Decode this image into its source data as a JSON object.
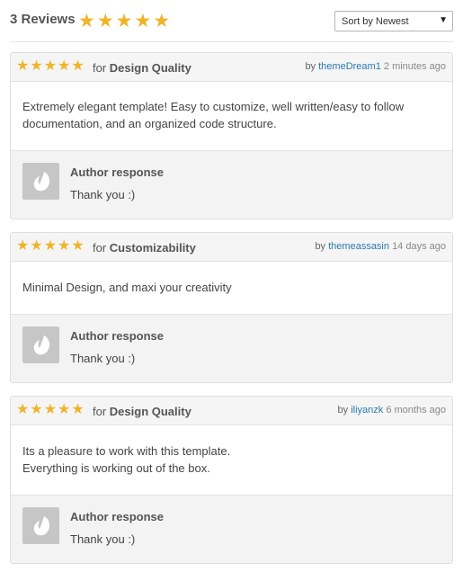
{
  "header": {
    "review_count": "3 Reviews",
    "rating_stars": 5,
    "sort": {
      "selected": "Sort by Newest"
    }
  },
  "colors": {
    "star": "#f0b42a",
    "link": "#2a7ab0"
  },
  "reviews": [
    {
      "stars": 5,
      "for_prefix": "for",
      "category": "Design Quality",
      "by_prefix": "by",
      "username": "themeDream1",
      "time": "2 minutes ago",
      "body": [
        "Extremely elegant template! Easy to customize, well written/easy to follow documentation, and an organized code structure."
      ],
      "response": {
        "title": "Author response",
        "text": "Thank you :)"
      }
    },
    {
      "stars": 5,
      "for_prefix": "for",
      "category": "Customizability",
      "by_prefix": "by",
      "username": "themeassasin",
      "time": "14 days ago",
      "body": [
        "Minimal Design, and maxi your creativity"
      ],
      "response": {
        "title": "Author response",
        "text": "Thank you :)"
      }
    },
    {
      "stars": 5,
      "for_prefix": "for",
      "category": "Design Quality",
      "by_prefix": "by",
      "username": "iliyanzk",
      "time": "6 months ago",
      "body": [
        "Its a pleasure to work with this template.",
        "Everything is working out of the box."
      ],
      "response": {
        "title": "Author response",
        "text": "Thank you :)"
      }
    }
  ]
}
